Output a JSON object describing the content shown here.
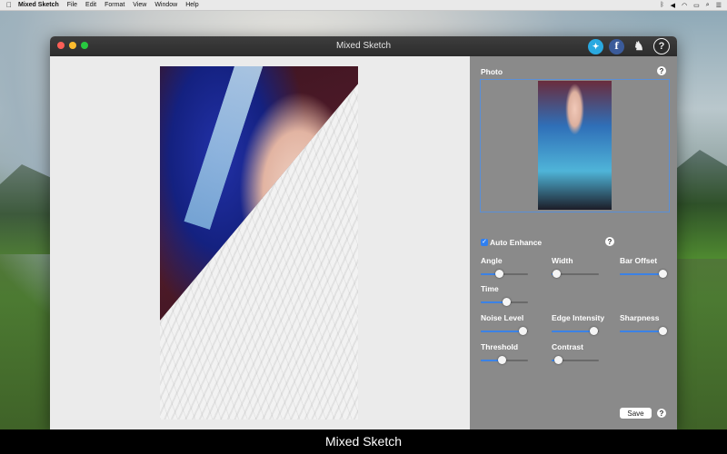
{
  "menubar": {
    "apple_icon": "apple-icon",
    "items": [
      "Mixed Sketch",
      "File",
      "Edit",
      "Format",
      "View",
      "Window",
      "Help"
    ]
  },
  "window": {
    "title": "Mixed Sketch",
    "toolbar_icons": [
      "twitter-icon",
      "facebook-icon",
      "horse-icon",
      "help-icon"
    ]
  },
  "panel": {
    "photo_label": "Photo",
    "auto_enhance_label": "Auto Enhance",
    "auto_enhance_checked": true,
    "sliders": {
      "angle": {
        "label": "Angle",
        "value": 0.4
      },
      "width": {
        "label": "Width",
        "value": 0.1
      },
      "bar_offset": {
        "label": "Bar Offset",
        "value": 0.98
      },
      "time": {
        "label": "Time",
        "value": 0.55
      },
      "noise_level": {
        "label": "Noise Level",
        "value": 0.9
      },
      "edge_intensity": {
        "label": "Edge Intensity",
        "value": 0.9
      },
      "sharpness": {
        "label": "Sharpness",
        "value": 0.98
      },
      "threshold": {
        "label": "Threshold",
        "value": 0.45
      },
      "contrast": {
        "label": "Contrast",
        "value": 0.15
      }
    },
    "help_glyph": "?",
    "save_label": "Save"
  },
  "caption": "Mixed Sketch",
  "colors": {
    "accent": "#3b82e6",
    "panel_bg": "#8a8a8a",
    "titlebar": "#333333"
  }
}
